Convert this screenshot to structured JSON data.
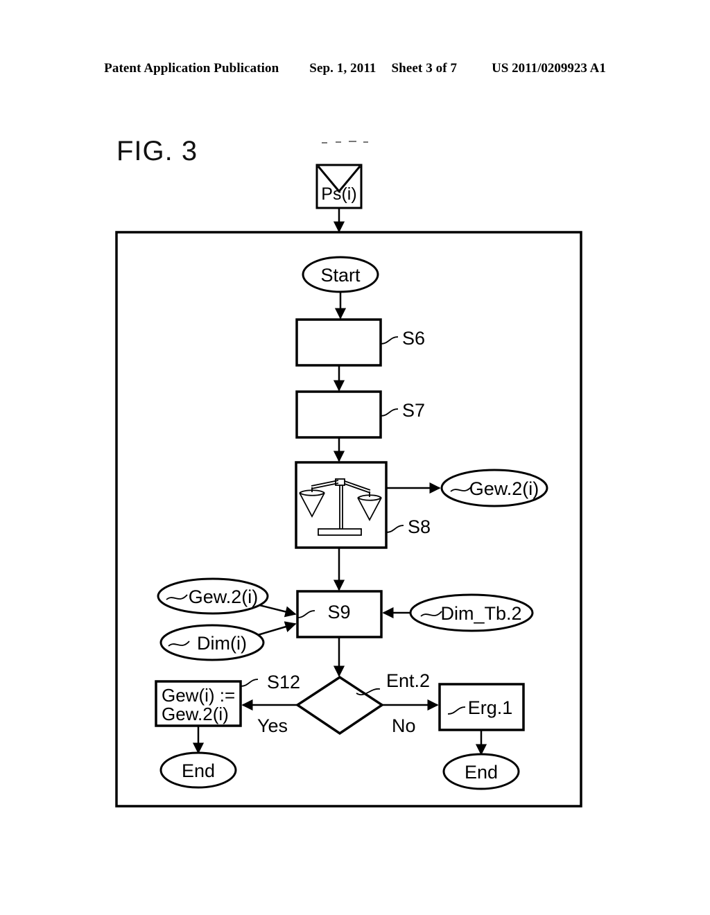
{
  "header": {
    "publication": "Patent Application Publication",
    "date": "Sep. 1, 2011",
    "sheet": "Sheet 3 of 7",
    "number": "US 2011/0209923 A1"
  },
  "figure": {
    "label": "FIG. 3",
    "input_envelope": {
      "icon": "envelope-icon",
      "label": "Ps(i)"
    },
    "nodes": {
      "start": "Start",
      "s6_ref": "S6",
      "s7_ref": "S7",
      "s8_ref": "S8",
      "s8_icon": "balance-scale-icon",
      "s8_output": "Gew.2(i)",
      "s9_label": "S9",
      "s9_input_left_top": "Gew.2(i)",
      "s9_input_left_bottom": "Dim(i)",
      "s9_input_right": "Dim_Tb.2",
      "decision_ref": "Ent.2",
      "branch_yes": "Yes",
      "branch_no": "No",
      "s12_ref": "S12",
      "s12_line1": "Gew(i) :=",
      "s12_line2": "Gew.2(i)",
      "erg_label": "Erg.1",
      "end_left": "End",
      "end_right": "End"
    }
  },
  "colors": {
    "ink": "#000000",
    "paper": "#ffffff"
  }
}
